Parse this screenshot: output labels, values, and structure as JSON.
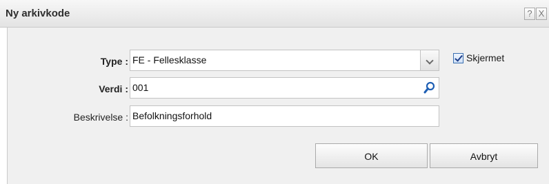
{
  "dialog": {
    "title": "Ny arkivkode",
    "help_label": "?",
    "close_label": "X"
  },
  "form": {
    "type": {
      "label": "Type :",
      "value": "FE - Fellesklasse"
    },
    "verdi": {
      "label": "Verdi :",
      "value": "001"
    },
    "beskrivelse": {
      "label": "Beskrivelse :",
      "value": "Befolkningsforhold"
    },
    "skjermet": {
      "label": "Skjermet",
      "checked": true
    }
  },
  "buttons": {
    "ok_label": "OK",
    "cancel_label": "Avbryt"
  },
  "icons": {
    "search": "magnifier-icon",
    "dropdown": "chevron-down-icon",
    "check": "checkmark-icon"
  },
  "colors": {
    "accent": "#1e5fb4",
    "checkbox_border": "#3a6fb0"
  }
}
